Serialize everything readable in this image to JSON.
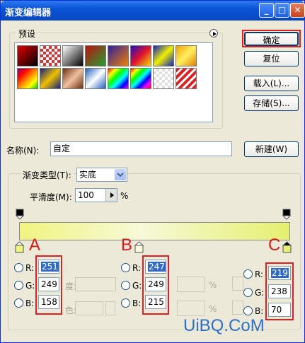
{
  "window": {
    "title": "渐变编辑器",
    "minimize": "_",
    "maximize": "□",
    "close": "✕"
  },
  "presets": {
    "label": "预设",
    "menu_icon": "circle-arrow"
  },
  "buttons": {
    "ok": "确定",
    "reset": "复位",
    "load": "载入(L)...",
    "save": "存储(S)...",
    "new": "新建(W)"
  },
  "name": {
    "label": "名称(N):",
    "value": "自定"
  },
  "gradient": {
    "type_label": "渐变类型(T):",
    "type_value": "实底",
    "smooth_label": "平滑度(M):",
    "smooth_value": "100",
    "smooth_unit": "%",
    "start_color": "#f0f480",
    "mid_color": "#f7f9d8",
    "end_color": "#e5ef70"
  },
  "annotations": {
    "a": "A",
    "b": "B",
    "c": "C"
  },
  "colors": {
    "a": {
      "r": "251",
      "g": "249",
      "b": "158"
    },
    "b": {
      "r": "247",
      "g": "249",
      "b": "215"
    },
    "c": {
      "r": "219",
      "g": "238",
      "b": "70"
    }
  },
  "rgb_labels": {
    "r": "R:",
    "g": "G:",
    "b": "B:"
  },
  "hidden_labels": {
    "opacity_tail": "度:",
    "color_tail": "色:",
    "pct": "%"
  },
  "watermark": "UiBQ.CoM"
}
